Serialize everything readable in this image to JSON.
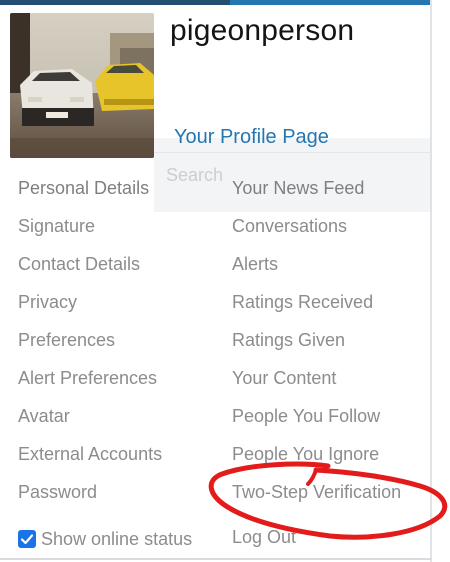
{
  "user": {
    "username": "pigeonperson",
    "profile_link": "Your Profile Page"
  },
  "search": {
    "ghost_text": "Search"
  },
  "menu": {
    "left": [
      "Personal Details",
      "Signature",
      "Contact Details",
      "Privacy",
      "Preferences",
      "Alert Preferences",
      "Avatar",
      "External Accounts",
      "Password"
    ],
    "right": [
      "Your News Feed",
      "Conversations",
      "Alerts",
      "Ratings Received",
      "Ratings Given",
      "Your Content",
      "People You Follow",
      "People You Ignore",
      "Two-Step Verification"
    ]
  },
  "online_status": {
    "label": "Show online status",
    "checked": true
  },
  "logout": {
    "label": "Log Out"
  },
  "colors": {
    "accent": "#2577b1",
    "menu_text": "#8c8c8c",
    "annotation": "#e31b1b",
    "checkbox": "#1a73e8"
  },
  "icons": {
    "checkbox": "checkmark-icon"
  }
}
